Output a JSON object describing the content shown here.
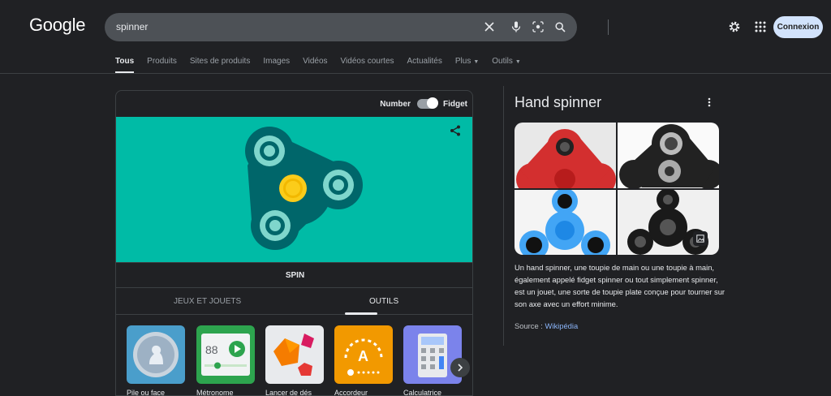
{
  "header": {
    "logo": "Google",
    "search_value": "spinner",
    "connexion_label": "Connexion"
  },
  "tabs": [
    {
      "label": "Tous",
      "active": true
    },
    {
      "label": "Produits"
    },
    {
      "label": "Sites de produits"
    },
    {
      "label": "Images"
    },
    {
      "label": "Vidéos"
    },
    {
      "label": "Vidéos courtes"
    },
    {
      "label": "Actualités"
    },
    {
      "label": "Plus",
      "dropdown": true
    },
    {
      "label": "Outils",
      "dropdown": true
    }
  ],
  "spinner_widget": {
    "mode_left": "Number",
    "mode_right": "Fidget",
    "spin_label": "SPIN",
    "categories": [
      "JEUX ET JOUETS",
      "OUTILS"
    ],
    "active_category": "OUTILS",
    "tools": [
      "Pile ou face",
      "Métronome",
      "Lancer de dés",
      "Accordeur",
      "Calculatrice"
    ],
    "metronome_value": "88",
    "tuner_note": "A",
    "colors": {
      "stage": "#00bba6",
      "spinner_body": "#00666a",
      "center": "#fbcc1a",
      "bearing": "#7fd6cc"
    }
  },
  "knowledge_panel": {
    "title": "Hand spinner",
    "description": "Un hand spinner, une toupie de main ou une toupie à main, également appelé fidget spinner ou tout simplement spinner, est un jouet, une sorte de toupie plate conçue pour tourner sur son axe avec un effort minime.",
    "source_label": "Source : ",
    "source_link": "Wikipédia"
  }
}
